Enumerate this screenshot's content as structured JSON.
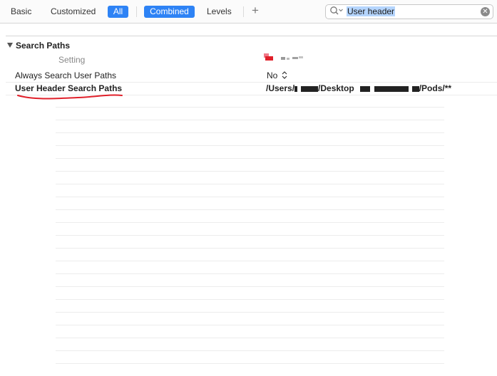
{
  "toolbar": {
    "basic_label": "Basic",
    "customized_label": "Customized",
    "all_label": "All",
    "combined_label": "Combined",
    "levels_label": "Levels",
    "add_label": "+"
  },
  "search": {
    "value": "User header",
    "clear_label": "✕"
  },
  "section": {
    "title": "Search Paths",
    "column_setting": "Setting"
  },
  "rows": [
    {
      "name": "Always Search User Paths",
      "value": "No"
    },
    {
      "name": "User Header Search Paths",
      "value_prefix": "/Users/",
      "value_mid": "/Desktop",
      "value_suffix": "/Pods/**"
    }
  ],
  "colors": {
    "accent": "#2e83f5",
    "search_highlight": "#b5d5fd",
    "annotation_red": "#e0202a"
  }
}
